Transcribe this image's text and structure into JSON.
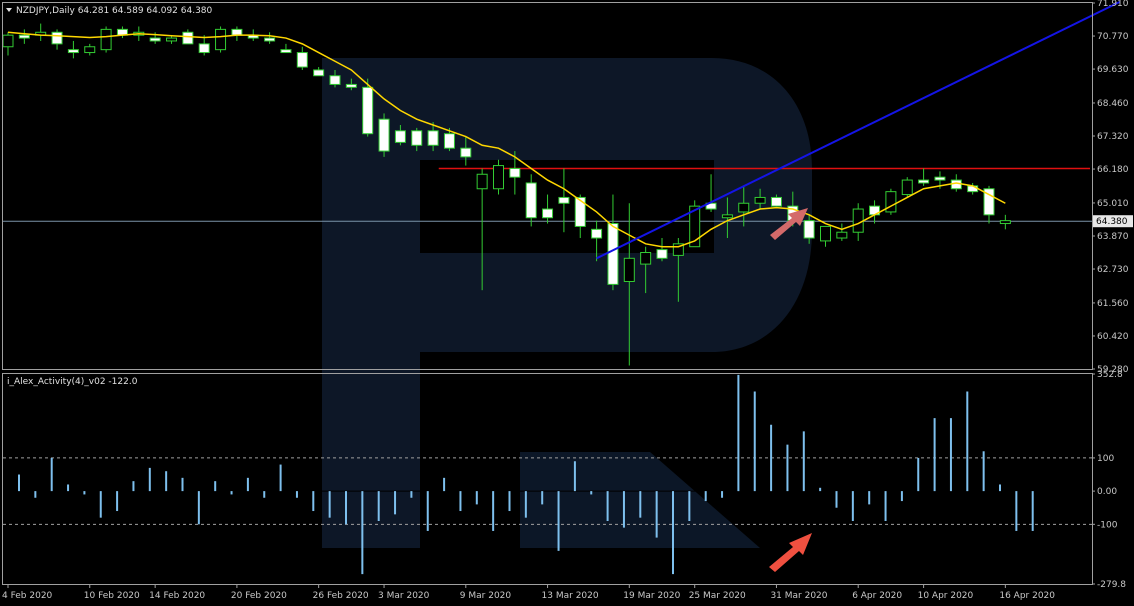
{
  "chart_data": [
    {
      "type": "candlestick",
      "header": "NZDJPY,Daily  64.281 64.589 64.092 64.380",
      "price_axis": {
        "ylim": [
          59.28,
          71.91
        ],
        "ticks": [
          "71.910",
          "70.770",
          "69.630",
          "68.460",
          "67.320",
          "66.180",
          "65.010",
          "63.870",
          "62.730",
          "61.560",
          "60.420",
          "59.280"
        ],
        "current_price": 64.38,
        "current_price_label": "64.380"
      },
      "x_ticks": [
        "4 Feb 2020",
        "10 Feb 2020",
        "14 Feb 2020",
        "20 Feb 2020",
        "26 Feb 2020",
        "3 Mar 2020",
        "9 Mar 2020",
        "13 Mar 2020",
        "19 Mar 2020",
        "25 Mar 2020",
        "31 Mar 2020",
        "6 Apr 2020",
        "10 Apr 2020",
        "16 Apr 2020"
      ],
      "candles": [
        [
          70.4,
          70.9,
          70.1,
          70.8
        ],
        [
          70.8,
          71.0,
          70.5,
          70.7
        ],
        [
          70.8,
          71.2,
          70.6,
          70.9
        ],
        [
          70.9,
          71.0,
          70.3,
          70.5
        ],
        [
          70.3,
          70.6,
          70.0,
          70.2
        ],
        [
          70.2,
          70.5,
          70.1,
          70.4
        ],
        [
          70.3,
          71.1,
          70.2,
          71.0
        ],
        [
          71.0,
          71.1,
          70.7,
          70.8
        ],
        [
          70.8,
          71.1,
          70.6,
          70.9
        ],
        [
          70.7,
          70.9,
          70.5,
          70.6
        ],
        [
          70.6,
          70.8,
          70.5,
          70.7
        ],
        [
          70.9,
          71.0,
          70.5,
          70.5
        ],
        [
          70.5,
          70.8,
          70.1,
          70.2
        ],
        [
          70.3,
          71.1,
          70.2,
          71.0
        ],
        [
          71.0,
          71.1,
          70.6,
          70.8
        ],
        [
          70.8,
          71.0,
          70.6,
          70.7
        ],
        [
          70.7,
          70.9,
          70.5,
          70.6
        ],
        [
          70.3,
          70.5,
          70.2,
          70.2
        ],
        [
          70.2,
          70.4,
          69.6,
          69.7
        ],
        [
          69.6,
          69.7,
          69.4,
          69.4
        ],
        [
          69.4,
          69.6,
          69.0,
          69.1
        ],
        [
          69.1,
          69.3,
          68.9,
          69.0
        ],
        [
          69.0,
          69.3,
          67.3,
          67.4
        ],
        [
          67.9,
          68.1,
          66.6,
          66.8
        ],
        [
          67.5,
          67.7,
          67.0,
          67.1
        ],
        [
          67.5,
          67.6,
          66.8,
          67.0
        ],
        [
          67.5,
          67.8,
          66.8,
          67.0
        ],
        [
          67.4,
          67.6,
          66.8,
          66.9
        ],
        [
          66.9,
          67.3,
          66.3,
          66.6
        ],
        [
          65.5,
          66.2,
          62.0,
          66.0
        ],
        [
          65.5,
          66.5,
          65.3,
          66.3
        ],
        [
          66.2,
          66.8,
          65.3,
          65.9
        ],
        [
          65.7,
          66.0,
          64.2,
          64.5
        ],
        [
          64.8,
          65.3,
          64.3,
          64.5
        ],
        [
          65.2,
          66.2,
          64.0,
          65.0
        ],
        [
          65.2,
          65.3,
          63.8,
          64.2
        ],
        [
          64.1,
          64.4,
          63.0,
          63.8
        ],
        [
          64.3,
          65.3,
          62.0,
          62.2
        ],
        [
          62.3,
          65.0,
          59.4,
          63.1
        ],
        [
          62.9,
          63.5,
          61.9,
          63.3
        ],
        [
          63.4,
          63.8,
          63.0,
          63.1
        ],
        [
          63.2,
          63.8,
          61.6,
          63.6
        ],
        [
          63.5,
          65.1,
          63.5,
          64.9
        ],
        [
          65.0,
          66.0,
          64.7,
          64.8
        ],
        [
          64.5,
          65.2,
          63.8,
          64.6
        ],
        [
          64.7,
          65.6,
          64.2,
          65.0
        ],
        [
          65.0,
          65.5,
          64.8,
          65.2
        ],
        [
          65.2,
          65.3,
          64.9,
          64.9
        ],
        [
          64.9,
          65.4,
          64.2,
          64.4
        ],
        [
          64.4,
          64.6,
          63.6,
          63.8
        ],
        [
          63.7,
          64.2,
          63.5,
          64.2
        ],
        [
          63.8,
          64.3,
          63.7,
          64.0
        ],
        [
          64.0,
          65.0,
          63.7,
          64.8
        ],
        [
          64.9,
          65.1,
          64.3,
          64.6
        ],
        [
          64.7,
          65.5,
          64.6,
          65.4
        ],
        [
          65.3,
          65.9,
          65.2,
          65.8
        ],
        [
          65.8,
          66.2,
          65.6,
          65.7
        ],
        [
          65.9,
          66.1,
          65.5,
          65.8
        ],
        [
          65.8,
          66.0,
          65.4,
          65.5
        ],
        [
          65.6,
          65.7,
          65.3,
          65.4
        ],
        [
          65.5,
          65.6,
          64.3,
          64.6
        ],
        [
          64.3,
          64.6,
          64.1,
          64.4
        ]
      ],
      "moving_average": [
        70.9,
        70.85,
        70.8,
        70.78,
        70.75,
        70.72,
        70.75,
        70.8,
        70.85,
        70.82,
        70.78,
        70.75,
        70.72,
        70.75,
        70.8,
        70.8,
        70.78,
        70.7,
        70.5,
        70.2,
        69.9,
        69.6,
        69.1,
        68.6,
        68.2,
        67.9,
        67.7,
        67.5,
        67.3,
        67.0,
        66.9,
        66.6,
        66.2,
        65.8,
        65.5,
        65.1,
        64.7,
        64.2,
        63.9,
        63.6,
        63.5,
        63.5,
        63.7,
        64.1,
        64.4,
        64.6,
        64.8,
        64.85,
        64.8,
        64.6,
        64.3,
        64.1,
        64.3,
        64.6,
        64.9,
        65.2,
        65.5,
        65.6,
        65.7,
        65.6,
        65.3,
        65.0
      ],
      "trendline": {
        "from": [
          36,
          63.1
        ],
        "to": [
          68,
          71.95
        ]
      },
      "resistance": {
        "level": 66.2,
        "from_index": 25
      }
    },
    {
      "type": "bar",
      "header": "i_Alex_Activity(4)_v02 -122.0",
      "ylim": [
        -279.8,
        352.8
      ],
      "ticks": [
        "352.8",
        "100",
        "0.00",
        "-100",
        "-279.8"
      ],
      "levels": [
        100,
        0,
        -100
      ],
      "values": [
        50,
        -20,
        100,
        20,
        -10,
        -80,
        -60,
        30,
        70,
        60,
        40,
        -100,
        30,
        -10,
        40,
        -20,
        80,
        -20,
        -60,
        -80,
        -100,
        -250,
        -90,
        -70,
        -20,
        -120,
        40,
        -60,
        -40,
        -120,
        -60,
        -80,
        -40,
        -180,
        90,
        -10,
        -90,
        -110,
        -80,
        -140,
        -250,
        -90,
        -30,
        -20,
        350,
        300,
        200,
        140,
        180,
        10,
        -50,
        -90,
        -40,
        -90,
        -30,
        100,
        220,
        220,
        300,
        120,
        20,
        -120,
        -120
      ]
    }
  ]
}
